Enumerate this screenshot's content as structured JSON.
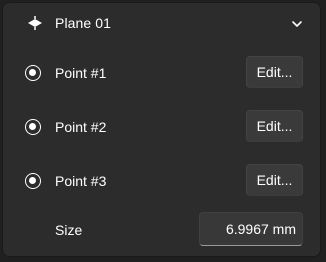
{
  "header": {
    "title": "Plane 01",
    "icon": "plane-icon",
    "expand_icon": "chevron-down-icon"
  },
  "points": [
    {
      "label": "Point #1",
      "selected": true,
      "edit_label": "Edit..."
    },
    {
      "label": "Point #2",
      "selected": true,
      "edit_label": "Edit..."
    },
    {
      "label": "Point #3",
      "selected": true,
      "edit_label": "Edit..."
    }
  ],
  "size": {
    "label": "Size",
    "value": "6.9967 mm"
  },
  "colors": {
    "background": "#202020",
    "panel": "#2c2c2c",
    "button": "#3a3a3a",
    "text": "#ffffff"
  }
}
